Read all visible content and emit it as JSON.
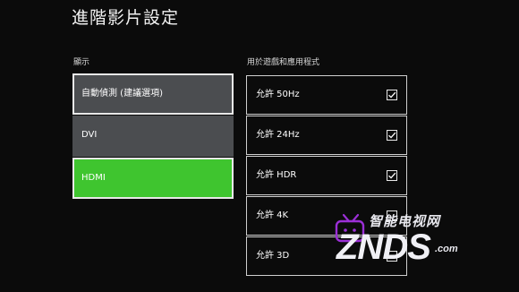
{
  "page": {
    "title": "進階影片設定"
  },
  "display": {
    "label": "顯示",
    "options": [
      {
        "label": "自動偵測 (建議選項)",
        "selected": false
      },
      {
        "label": "DVI",
        "selected": false
      },
      {
        "label": "HDMI",
        "selected": true
      }
    ]
  },
  "apps": {
    "label": "用於遊戲和應用程式",
    "options": [
      {
        "label": "允許 50Hz",
        "checked": true
      },
      {
        "label": "允許 24Hz",
        "checked": true
      },
      {
        "label": "允許 HDR",
        "checked": true
      },
      {
        "label": "允許 4K",
        "checked": false
      },
      {
        "label": "允許 3D",
        "checked": false
      }
    ]
  },
  "watermark": {
    "chinese": "智能电视网",
    "logo": "ZNDS",
    "suffix": ".com"
  },
  "colors": {
    "background": "#0b0b0b",
    "option_bg": "#4b4d50",
    "selected_bg": "#3fc52f",
    "border": "#e8e8e8",
    "watermark_accent": "#9b2fd6"
  },
  "icons": {
    "checkbox": "checkmark-icon",
    "watermark_tv": "tv-icon"
  }
}
